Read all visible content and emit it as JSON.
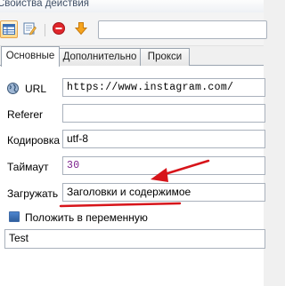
{
  "window": {
    "title": "Свойства действия"
  },
  "toolbar": {
    "buttons": [
      {
        "icon": "table-icon"
      },
      {
        "icon": "edit-note-icon"
      },
      {
        "icon": "stop-icon"
      },
      {
        "icon": "arrow-down-icon"
      }
    ],
    "search_value": ""
  },
  "tabs": [
    {
      "label": "Основные",
      "active": true
    },
    {
      "label": "Дополнительно",
      "active": false
    },
    {
      "label": "Прокси",
      "active": false
    }
  ],
  "form": {
    "url": {
      "label": "URL",
      "value": "https://www.instagram.com/"
    },
    "referer": {
      "label": "Referer",
      "value": ""
    },
    "encoding": {
      "label": "Кодировка",
      "value": "utf-8"
    },
    "timeout": {
      "label": "Таймаут",
      "value": "30"
    },
    "load": {
      "label": "Загружать",
      "value": "Заголовки и содержимое"
    },
    "save_to_var": {
      "label": "Положить в переменную",
      "checked": true
    },
    "variable": {
      "value": "Test"
    }
  },
  "colors": {
    "annotation_arrow": "#d7141a",
    "tab_border": "#9aa4b0",
    "timeout_value": "#7a1e8c"
  }
}
